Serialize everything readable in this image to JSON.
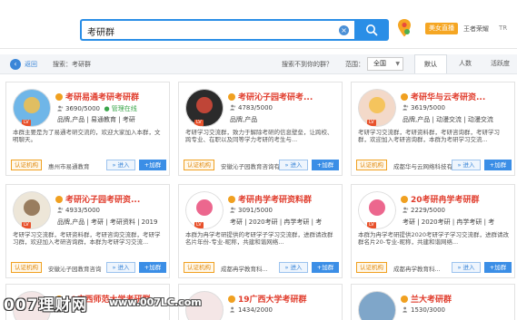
{
  "search": {
    "query": "考研群",
    "button_icon": "search-icon",
    "clear_icon": "clear-icon"
  },
  "header": {
    "promo": "美女直播",
    "user": "王者荣耀",
    "extra": "TR"
  },
  "filter": {
    "back": "返回",
    "search_label": "搜索：考研群",
    "notfound": "搜索不到你的群？",
    "range_label": "范围：",
    "range_value": "全国",
    "tabs": [
      "默认",
      "人数",
      "活跃度"
    ]
  },
  "card_labels": {
    "cert": "认证机构",
    "enter": "» 进入",
    "join": "+加群"
  },
  "cards": [
    {
      "name": "考研易通考研考研群",
      "count": "3690/5000",
      "badge": "管理在线",
      "tags": "品牌,产品 | 易通教育 | 考研",
      "desc": "本群主要是为了易通考研交流的，欢迎大家加入本群，文明聊天。",
      "org": "惠州市易通教育",
      "avatar_color": "#6fb6e8"
    },
    {
      "name": "考研沁子园考研考...",
      "count": "4783/5000",
      "badge": "",
      "tags": "品牌,产品",
      "desc": "考研学习交流群，致力于解除考研的信息壁垒，让跨校、跨专业、在职以及同等学力考研的考生与...",
      "org": "安徽沁子园教育咨询有限公司",
      "avatar_color": "#2b2b2b"
    },
    {
      "name": "考研华与云考研资...",
      "count": "3619/5000",
      "badge": "",
      "tags": "品牌,产品 | 动漫交流 | 动漫交流",
      "desc": "考研学习交流群，考研资料群，考研咨询群，考研学习群，欢迎加入考研咨询群，本群为考研学习交流...",
      "org": "成都华与云网络科技有限公司",
      "avatar_color": "#f3d9c9"
    },
    {
      "name": "考研沁子园考研资...",
      "count": "4933/5000",
      "badge": "",
      "tags": "品牌,产品 | 考研 | 考研资料 | 2019",
      "desc": "考研学习交流群，考研资料群，考研咨询交流群，考研学习群，欢迎加入考研咨询群，本群为考研学习交流...",
      "org": "安徽沁子园教育咨询",
      "avatar_color": "#ede6d8"
    },
    {
      "name": "考研冉学考研资料群",
      "count": "3091/5000",
      "badge": "",
      "tags": "考研 | 2020考研 | 冉学考研 | 考",
      "desc": "本群为冉学考研提供的考研学子学习交流群，进群请改群名片年份-专业-昵称，共建和谐网络...",
      "org": "成都冉学教育科...",
      "avatar_color": "#ffffff"
    },
    {
      "name": "20考研冉学考研群",
      "count": "2229/5000",
      "badge": "",
      "tags": "考研 | 2020考研 | 冉学考研 | 考",
      "desc": "本群为冉学考研提供2020考研学子学习交流群，进群请改群名片20-专业-昵称，共建和谐网络...",
      "org": "成都冉学教育科...",
      "avatar_color": "#ffffff"
    }
  ],
  "partial_cards": [
    {
      "name": "19广西师范大学考研群",
      "count": ""
    },
    {
      "name": "19广西大学考研群",
      "count": "1434/2000"
    },
    {
      "name": "兰大考研群",
      "count": "1530/3000"
    }
  ],
  "watermark": {
    "brand": "007理财网",
    "url": "www.007LC.com"
  }
}
